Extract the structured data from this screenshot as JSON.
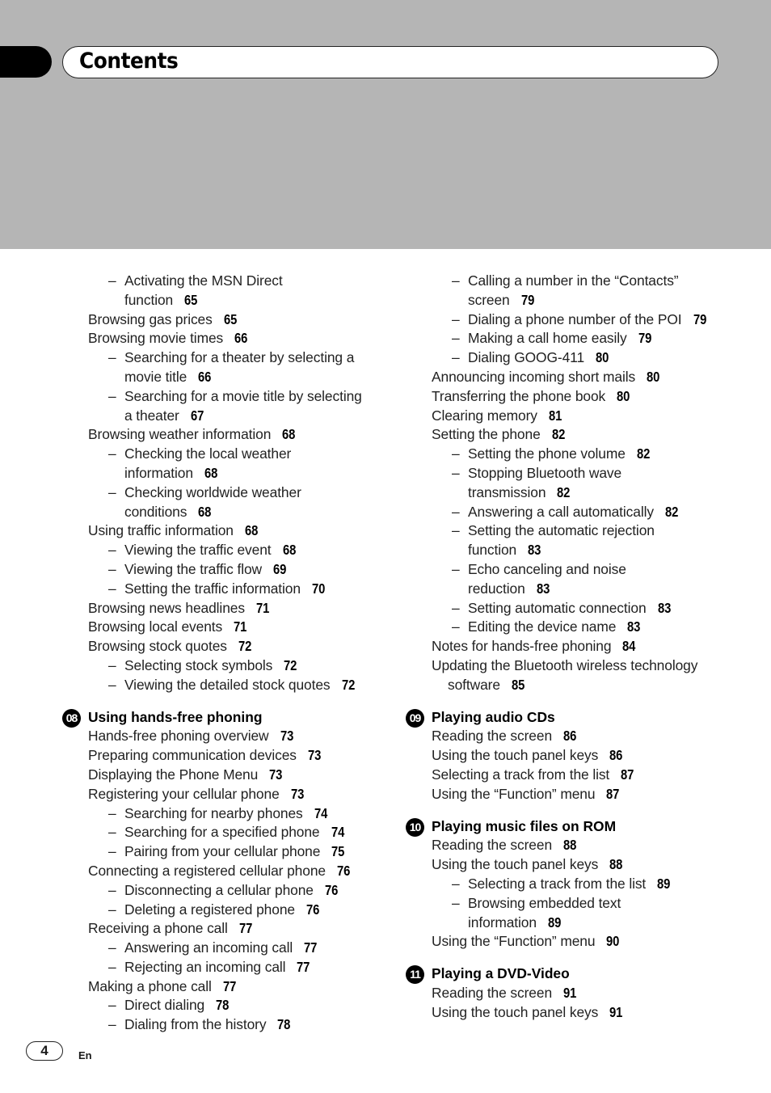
{
  "header": {
    "title": "Contents"
  },
  "left_column": [
    {
      "type": "sub",
      "text": "Activating the MSN Direct",
      "page": ""
    },
    {
      "type": "cont2",
      "text": "function",
      "page": "65"
    },
    {
      "type": "item",
      "text": "Browsing gas prices",
      "page": "65"
    },
    {
      "type": "item",
      "text": "Browsing movie times",
      "page": "66"
    },
    {
      "type": "sub",
      "text": "Searching for a theater by selecting a",
      "page": ""
    },
    {
      "type": "cont2",
      "text": "movie title",
      "page": "66"
    },
    {
      "type": "sub",
      "text": "Searching for a movie title by selecting",
      "page": ""
    },
    {
      "type": "cont2",
      "text": "a theater",
      "page": "67"
    },
    {
      "type": "item",
      "text": "Browsing weather information",
      "page": "68"
    },
    {
      "type": "sub",
      "text": "Checking the local weather",
      "page": ""
    },
    {
      "type": "cont2",
      "text": "information",
      "page": "68"
    },
    {
      "type": "sub",
      "text": "Checking worldwide weather",
      "page": ""
    },
    {
      "type": "cont2",
      "text": "conditions",
      "page": "68"
    },
    {
      "type": "item",
      "text": "Using traffic information",
      "page": "68"
    },
    {
      "type": "sub",
      "text": "Viewing the traffic event",
      "page": "68"
    },
    {
      "type": "sub",
      "text": "Viewing the traffic flow",
      "page": "69"
    },
    {
      "type": "sub",
      "text": "Setting the traffic information",
      "page": "70"
    },
    {
      "type": "item",
      "text": "Browsing news headlines",
      "page": "71"
    },
    {
      "type": "item",
      "text": "Browsing local events",
      "page": "71"
    },
    {
      "type": "item",
      "text": "Browsing stock quotes",
      "page": "72"
    },
    {
      "type": "sub",
      "text": "Selecting stock symbols",
      "page": "72"
    },
    {
      "type": "sub",
      "text": "Viewing the detailed stock quotes",
      "page": "72"
    },
    {
      "type": "gap"
    },
    {
      "type": "section",
      "number": "08",
      "text": "Using hands-free phoning"
    },
    {
      "type": "item",
      "text": "Hands-free phoning overview",
      "page": "73"
    },
    {
      "type": "item",
      "text": "Preparing communication devices",
      "page": "73"
    },
    {
      "type": "item",
      "text": "Displaying the Phone Menu",
      "page": "73"
    },
    {
      "type": "item",
      "text": "Registering your cellular phone",
      "page": "73"
    },
    {
      "type": "sub",
      "text": "Searching for nearby phones",
      "page": "74"
    },
    {
      "type": "sub",
      "text": "Searching for a specified phone",
      "page": "74"
    },
    {
      "type": "sub",
      "text": "Pairing from your cellular phone",
      "page": "75"
    },
    {
      "type": "item",
      "text": "Connecting a registered cellular phone",
      "page": "76"
    },
    {
      "type": "sub",
      "text": "Disconnecting a cellular phone",
      "page": "76"
    },
    {
      "type": "sub",
      "text": "Deleting a registered phone",
      "page": "76"
    },
    {
      "type": "item",
      "text": "Receiving a phone call",
      "page": "77"
    },
    {
      "type": "sub",
      "text": "Answering an incoming call",
      "page": "77"
    },
    {
      "type": "sub",
      "text": "Rejecting an incoming call",
      "page": "77"
    },
    {
      "type": "item",
      "text": "Making a phone call",
      "page": "77"
    },
    {
      "type": "sub",
      "text": "Direct dialing",
      "page": "78"
    },
    {
      "type": "sub",
      "text": "Dialing from the history",
      "page": "78"
    }
  ],
  "right_column": [
    {
      "type": "sub",
      "text": "Calling a number in the “Contacts”",
      "page": ""
    },
    {
      "type": "cont2",
      "text": "screen",
      "page": "79"
    },
    {
      "type": "sub",
      "text": "Dialing a phone number of the POI",
      "page": "79"
    },
    {
      "type": "sub",
      "text": "Making a call home easily",
      "page": "79"
    },
    {
      "type": "sub",
      "text": "Dialing GOOG-411",
      "page": "80"
    },
    {
      "type": "item",
      "text": "Announcing incoming short mails",
      "page": "80"
    },
    {
      "type": "item",
      "text": "Transferring the phone book",
      "page": "80"
    },
    {
      "type": "item",
      "text": "Clearing memory",
      "page": "81"
    },
    {
      "type": "item",
      "text": "Setting the phone",
      "page": "82"
    },
    {
      "type": "sub",
      "text": "Setting the phone volume",
      "page": "82"
    },
    {
      "type": "sub",
      "text": "Stopping Bluetooth wave",
      "page": ""
    },
    {
      "type": "cont2",
      "text": "transmission",
      "page": "82"
    },
    {
      "type": "sub",
      "text": "Answering a call automatically",
      "page": "82"
    },
    {
      "type": "sub",
      "text": "Setting the automatic rejection",
      "page": ""
    },
    {
      "type": "cont2",
      "text": "function",
      "page": "83"
    },
    {
      "type": "sub",
      "text": "Echo canceling and noise",
      "page": ""
    },
    {
      "type": "cont2",
      "text": "reduction",
      "page": "83"
    },
    {
      "type": "sub",
      "text": "Setting automatic connection",
      "page": "83"
    },
    {
      "type": "sub",
      "text": "Editing the device name",
      "page": "83"
    },
    {
      "type": "item",
      "text": "Notes for hands-free phoning",
      "page": "84"
    },
    {
      "type": "item",
      "text": "Updating the Bluetooth wireless technology",
      "page": ""
    },
    {
      "type": "cont1",
      "text": "software",
      "page": "85"
    },
    {
      "type": "gap"
    },
    {
      "type": "section",
      "number": "09",
      "text": "Playing audio CDs"
    },
    {
      "type": "item",
      "text": "Reading the screen",
      "page": "86"
    },
    {
      "type": "item",
      "text": "Using the touch panel keys",
      "page": "86"
    },
    {
      "type": "item",
      "text": "Selecting a track from the list",
      "page": "87"
    },
    {
      "type": "item",
      "text": "Using the “Function” menu",
      "page": "87"
    },
    {
      "type": "gap"
    },
    {
      "type": "section",
      "number": "10",
      "text": "Playing music files on ROM"
    },
    {
      "type": "item",
      "text": "Reading the screen",
      "page": "88"
    },
    {
      "type": "item",
      "text": "Using the touch panel keys",
      "page": "88"
    },
    {
      "type": "sub",
      "text": "Selecting a track from the list",
      "page": "89"
    },
    {
      "type": "sub",
      "text": "Browsing embedded text",
      "page": ""
    },
    {
      "type": "cont2",
      "text": "information",
      "page": "89"
    },
    {
      "type": "item",
      "text": "Using the “Function” menu",
      "page": "90"
    },
    {
      "type": "gap"
    },
    {
      "type": "section",
      "number": "11",
      "text": "Playing a DVD-Video"
    },
    {
      "type": "item",
      "text": "Reading the screen",
      "page": "91"
    },
    {
      "type": "item",
      "text": "Using the touch panel keys",
      "page": "91"
    }
  ],
  "footer": {
    "page_number": "4",
    "language": "En"
  },
  "dash_glyph": "–"
}
